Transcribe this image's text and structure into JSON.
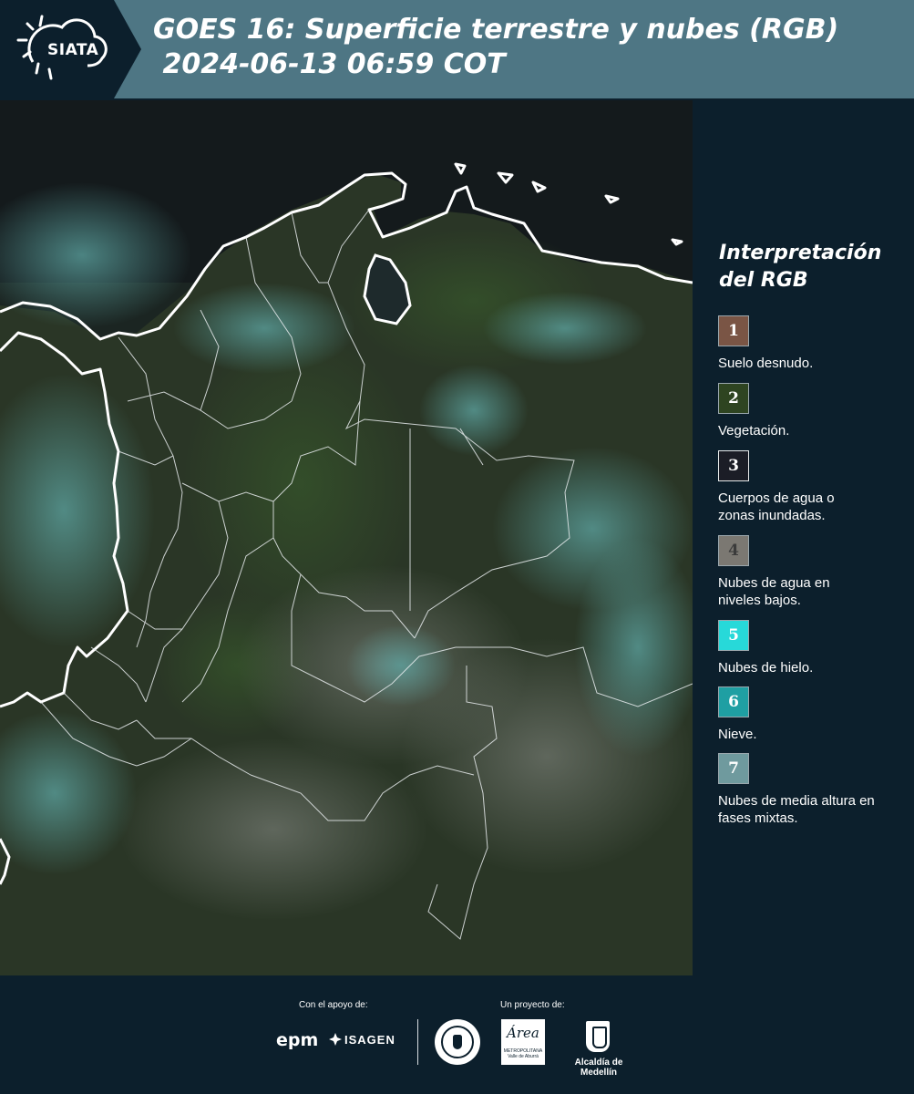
{
  "header": {
    "logo_text": "SIATA",
    "title_line1": "GOES 16: Superficie terrestre y nubes (RGB)",
    "title_line2": " 2024-06-13 06:59 COT"
  },
  "legend": {
    "title": "Interpretación del RGB",
    "items": [
      {
        "number": "1",
        "label": "Suelo desnudo.",
        "color": "#7a5545"
      },
      {
        "number": "2",
        "label": "Vegetación.",
        "color": "#2e4421"
      },
      {
        "number": "3",
        "label": "Cuerpos de agua o zonas inundadas.",
        "color": "#1b1d26"
      },
      {
        "number": "4",
        "label": "Nubes de agua en niveles bajos.",
        "color": "#7b7872"
      },
      {
        "number": "5",
        "label": "Nubes de hielo.",
        "color": "#27d9d9"
      },
      {
        "number": "6",
        "label": "Nieve.",
        "color": "#1f9fa3"
      },
      {
        "number": "7",
        "label": "Nubes de media altura en fases mixtas.",
        "color": "#6f9a9e"
      }
    ]
  },
  "map": {
    "ocean_color": "#1b2522",
    "land_color": "#2b3a28",
    "cloud_color": "#4f8e8c",
    "coast_color": "#ffffff"
  },
  "footer": {
    "support_label": "Con el apoyo de:",
    "project_label": "Un proyecto de:",
    "epm": "epm",
    "isagen": "ISAGEN",
    "metro_script": "Área",
    "metro_small": "METROPOLITANA Valle de Aburrá",
    "alcaldia": "Alcaldía de Medellín"
  }
}
